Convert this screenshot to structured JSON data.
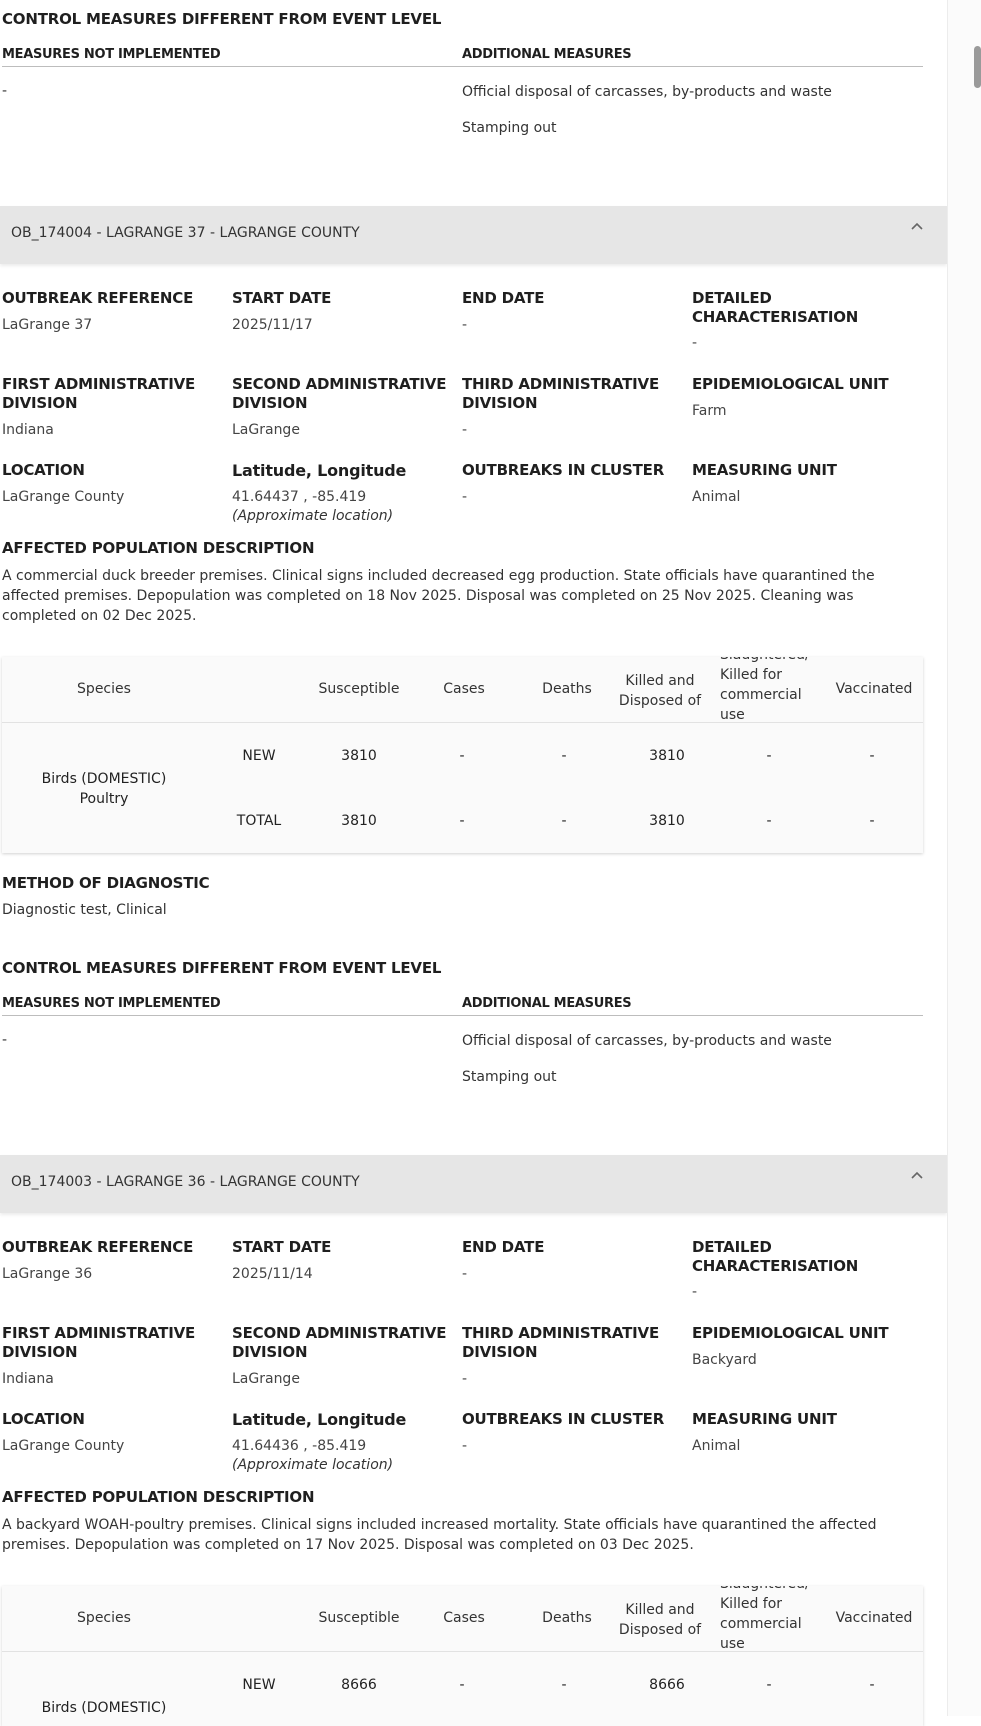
{
  "blocks": [
    {
      "control": {
        "heading": "CONTROL MEASURES DIFFERENT FROM EVENT LEVEL",
        "not_impl_label": "MEASURES NOT IMPLEMENTED",
        "additional_label": "ADDITIONAL MEASURES",
        "not_impl_value": "-",
        "additional": [
          "Official disposal of carcasses, by-products and waste",
          "Stamping out"
        ]
      }
    },
    {
      "title": "OB_174004 - LAGRANGE 37 - LAGRANGE COUNTY",
      "fields": {
        "outbreak_reference": {
          "label": "OUTBREAK REFERENCE",
          "value": "LaGrange 37"
        },
        "start_date": {
          "label": "START DATE",
          "value": "2025/11/17"
        },
        "end_date": {
          "label": "END DATE",
          "value": "-"
        },
        "detailed": {
          "label1": "DETAILED",
          "label2": "CHARACTERISATION",
          "value": "-"
        },
        "first_admin": {
          "label1": "FIRST ADMINISTRATIVE",
          "label2": "DIVISION",
          "value": "Indiana"
        },
        "second_admin": {
          "label1": "SECOND ADMINISTRATIVE",
          "label2": "DIVISION",
          "value": "LaGrange"
        },
        "third_admin": {
          "label1": "THIRD ADMINISTRATIVE",
          "label2": "DIVISION",
          "value": "-"
        },
        "epi_unit": {
          "label": "EPIDEMIOLOGICAL UNIT",
          "value": "Farm"
        },
        "location": {
          "label": "LOCATION",
          "value": "LaGrange County"
        },
        "latlon": {
          "label": "Latitude, Longitude",
          "value": "41.64437 , -85.419",
          "note": "(Approximate location)"
        },
        "outbreaks_cluster": {
          "label": "OUTBREAKS IN CLUSTER",
          "value": "-"
        },
        "measuring_unit": {
          "label": "MEASURING UNIT",
          "value": "Animal"
        }
      },
      "affected": {
        "heading": "AFFECTED POPULATION DESCRIPTION",
        "text": "A commercial duck breeder premises. Clinical signs included decreased egg production. State officials have quarantined the affected premises. Depopulation was completed on 18 Nov 2025. Disposal was completed on 25 Nov 2025. Cleaning was completed on 02 Dec 2025."
      },
      "table": {
        "headers": {
          "species": "Species",
          "susceptible": "Susceptible",
          "cases": "Cases",
          "deaths": "Deaths",
          "killed": "Killed and Disposed of",
          "slaughtered": "Slaughtered/ Killed for commercial use",
          "vaccinated": "Vaccinated"
        },
        "species": "Birds (DOMESTIC) Poultry",
        "rows": [
          {
            "label": "NEW",
            "susceptible": "3810",
            "cases": "-",
            "deaths": "-",
            "killed": "3810",
            "slaughtered": "-",
            "vaccinated": "-"
          },
          {
            "label": "TOTAL",
            "susceptible": "3810",
            "cases": "-",
            "deaths": "-",
            "killed": "3810",
            "slaughtered": "-",
            "vaccinated": "-"
          }
        ]
      },
      "diagnostic": {
        "heading": "METHOD OF DIAGNOSTIC",
        "value": "Diagnostic test, Clinical"
      },
      "control": {
        "heading": "CONTROL MEASURES DIFFERENT FROM EVENT LEVEL",
        "not_impl_label": "MEASURES NOT IMPLEMENTED",
        "additional_label": "ADDITIONAL MEASURES",
        "not_impl_value": "-",
        "additional": [
          "Official disposal of carcasses, by-products and waste",
          "Stamping out"
        ]
      }
    },
    {
      "title": "OB_174003 - LAGRANGE 36 - LAGRANGE COUNTY",
      "fields": {
        "outbreak_reference": {
          "label": "OUTBREAK REFERENCE",
          "value": "LaGrange 36"
        },
        "start_date": {
          "label": "START DATE",
          "value": "2025/11/14"
        },
        "end_date": {
          "label": "END DATE",
          "value": "-"
        },
        "detailed": {
          "label1": "DETAILED",
          "label2": "CHARACTERISATION",
          "value": "-"
        },
        "first_admin": {
          "label1": "FIRST ADMINISTRATIVE",
          "label2": "DIVISION",
          "value": "Indiana"
        },
        "second_admin": {
          "label1": "SECOND ADMINISTRATIVE",
          "label2": "DIVISION",
          "value": "LaGrange"
        },
        "third_admin": {
          "label1": "THIRD ADMINISTRATIVE",
          "label2": "DIVISION",
          "value": "-"
        },
        "epi_unit": {
          "label": "EPIDEMIOLOGICAL UNIT",
          "value": "Backyard"
        },
        "location": {
          "label": "LOCATION",
          "value": "LaGrange County"
        },
        "latlon": {
          "label": "Latitude, Longitude",
          "value": "41.64436 , -85.419",
          "note": "(Approximate location)"
        },
        "outbreaks_cluster": {
          "label": "OUTBREAKS IN CLUSTER",
          "value": "-"
        },
        "measuring_unit": {
          "label": "MEASURING UNIT",
          "value": "Animal"
        }
      },
      "affected": {
        "heading": "AFFECTED POPULATION DESCRIPTION",
        "text": "A backyard WOAH-poultry premises. Clinical signs included increased mortality. State officials have quarantined the affected premises. Depopulation was completed on 17 Nov 2025. Disposal was completed on 03 Dec 2025."
      },
      "table": {
        "headers": {
          "species": "Species",
          "susceptible": "Susceptible",
          "cases": "Cases",
          "deaths": "Deaths",
          "killed": "Killed and Disposed of",
          "slaughtered": "Slaughtered/ Killed for commercial use",
          "vaccinated": "Vaccinated"
        },
        "species": "Birds (DOMESTIC)",
        "rows": [
          {
            "label": "NEW",
            "susceptible": "8666",
            "cases": "-",
            "deaths": "-",
            "killed": "8666",
            "slaughtered": "-",
            "vaccinated": "-"
          }
        ]
      }
    }
  ],
  "icons": {
    "chevron_up": "chevron-up-icon"
  }
}
